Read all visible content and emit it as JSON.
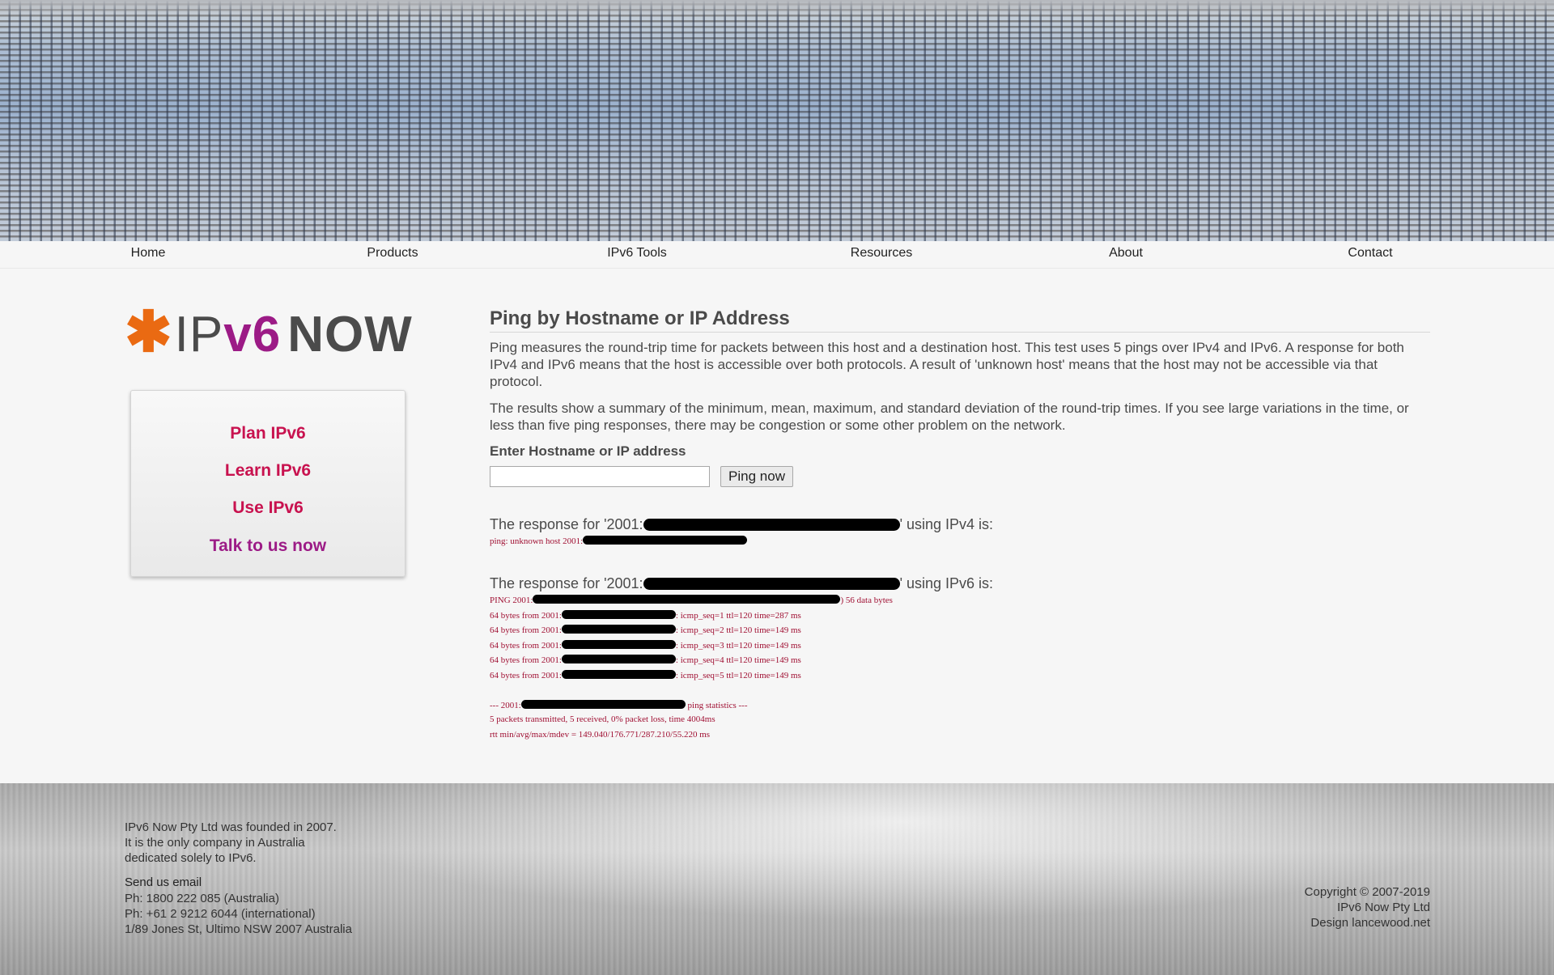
{
  "nav": {
    "items": [
      {
        "label": "Home"
      },
      {
        "label": "Products"
      },
      {
        "label": "IPv6 Tools"
      },
      {
        "label": "Resources"
      },
      {
        "label": "About"
      },
      {
        "label": "Contact"
      }
    ]
  },
  "logo": {
    "star": "✱",
    "ip": "IP",
    "v6": "v6",
    "now": "NOW"
  },
  "sidebar": {
    "links": [
      {
        "label": "Plan IPv6",
        "color": "#c8124f"
      },
      {
        "label": "Learn IPv6",
        "color": "#c8124f"
      },
      {
        "label": "Use IPv6",
        "color": "#c8124f"
      },
      {
        "label": "Talk to us now",
        "color": "#9c1b86"
      }
    ]
  },
  "main": {
    "title": "Ping by Hostname or IP Address",
    "para1": "Ping measures the round-trip time for packets between this host and a destination host. This test uses 5 pings over IPv4 and IPv6. A response for both IPv4 and IPv6 means that the host is accessible over both protocols. A result of 'unknown host' means that the host may not be accessible via that protocol.",
    "para2": "The results show a summary of the minimum, mean, maximum, and standard deviation of the round-trip times. If you see large variations in the time, or less than five ping responses, there may be congestion or some other problem on the network.",
    "form_label": "Enter Hostname or IP address",
    "input_value": "",
    "button_label": "Ping now"
  },
  "ipv4": {
    "head_pre": "The response for '2001:",
    "head_post": "' using IPv4 is:",
    "output": "ping: unknown host 2001:"
  },
  "ipv6": {
    "head_pre": "The response for '2001:",
    "head_post": "' using IPv6 is:",
    "ping_line_pre": "PING 2001:",
    "ping_line_post": ") 56 data bytes",
    "replies": [
      {
        "pre": "64 bytes from 2001:",
        "post": ": icmp_seq=1 ttl=120 time=287 ms"
      },
      {
        "pre": "64 bytes from 2001:",
        "post": ": icmp_seq=2 ttl=120 time=149 ms"
      },
      {
        "pre": "64 bytes from 2001:",
        "post": ": icmp_seq=3 ttl=120 time=149 ms"
      },
      {
        "pre": "64 bytes from 2001:",
        "post": ": icmp_seq=4 ttl=120 time=149 ms"
      },
      {
        "pre": "64 bytes from 2001:",
        "post": ": icmp_seq=5 ttl=120 time=149 ms"
      }
    ],
    "stats_pre": "--- 2001:",
    "stats_post": " ping statistics ---",
    "summary": "5 packets transmitted, 5 received, 0% packet loss, time 4004ms",
    "rtt": "rtt min/avg/max/mdev = 149.040/176.771/287.210/55.220 ms"
  },
  "footer": {
    "about": [
      "IPv6 Now Pty Ltd was founded in 2007.",
      "It is the only company in Australia",
      "dedicated solely to IPv6."
    ],
    "email_link": "Send us email",
    "contact": [
      "Ph: 1800 222 085 (Australia)",
      "Ph: +61 2 9212 6044 (international)",
      "1/89 Jones St, Ultimo NSW 2007 Australia"
    ],
    "copyright": [
      "Copyright © 2007-2019",
      "IPv6 Now Pty Ltd"
    ],
    "design_pre": "Design ",
    "design_link": "lancewood.net"
  }
}
